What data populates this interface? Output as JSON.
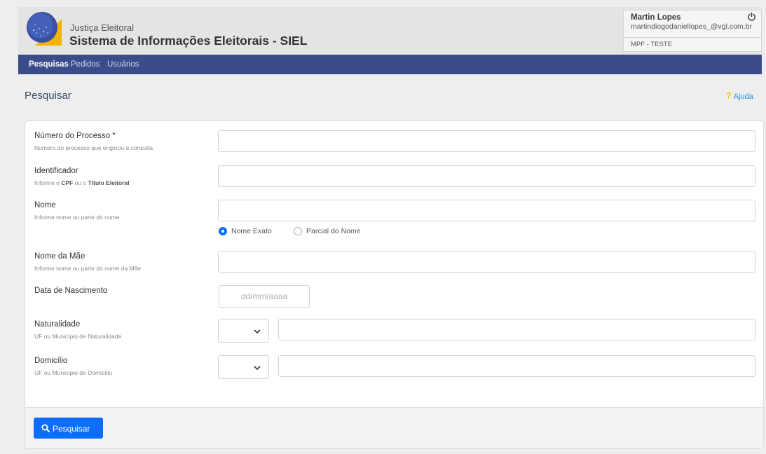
{
  "header": {
    "subtitle": "Justiça Eleitoral",
    "title": "Sistema de Informações Eleitorais - SIEL"
  },
  "user": {
    "name": "Martin Lopes",
    "email": "martindiogodaniellopes_@vgl.com.br",
    "org": "MPF - TESTE"
  },
  "nav": {
    "items": [
      {
        "label": "Pesquisas",
        "active": true
      },
      {
        "label": "Pedidos",
        "active": false
      },
      {
        "label": "Usuários",
        "active": false
      }
    ]
  },
  "page": {
    "title": "Pesquisar",
    "help_label": "Ajuda"
  },
  "form": {
    "processo": {
      "label": "Número do Processo *",
      "hint": "Número do processo que originou a consulta",
      "value": ""
    },
    "identificador": {
      "label": "Identificador",
      "hint_pre": "Informe o ",
      "hint_cpf": "CPF",
      "hint_mid": " ou o ",
      "hint_titulo": "Título Eleitoral",
      "value": ""
    },
    "nome": {
      "label": "Nome",
      "hint": "Informe nome ou parte do nome",
      "value": "",
      "radio_exact": "Nome Exato",
      "radio_partial": "Parcial do Nome",
      "selected": "Nome Exato"
    },
    "nome_mae": {
      "label": "Nome da Mãe",
      "hint": "Informe nome ou parte do nome da Mãe",
      "value": ""
    },
    "nascimento": {
      "label": "Data de Nascimento",
      "placeholder": "dd/mm/aaaa"
    },
    "naturalidade": {
      "label": "Naturalidade",
      "hint": "UF ou Município de Naturalidade",
      "uf": "",
      "municipio": ""
    },
    "domicilio": {
      "label": "Domicílio",
      "hint": "UF ou Município de Domicílio",
      "uf": "",
      "municipio": ""
    },
    "submit_label": "Pesquisar"
  },
  "colors": {
    "navbar": "#3b4c8a",
    "primary": "#0d6efd",
    "help_icon": "#ffc107",
    "link": "#1a8fd6"
  },
  "icons": [
    "logo-icon",
    "power-icon",
    "help-icon",
    "chevron-down-icon",
    "search-icon"
  ]
}
